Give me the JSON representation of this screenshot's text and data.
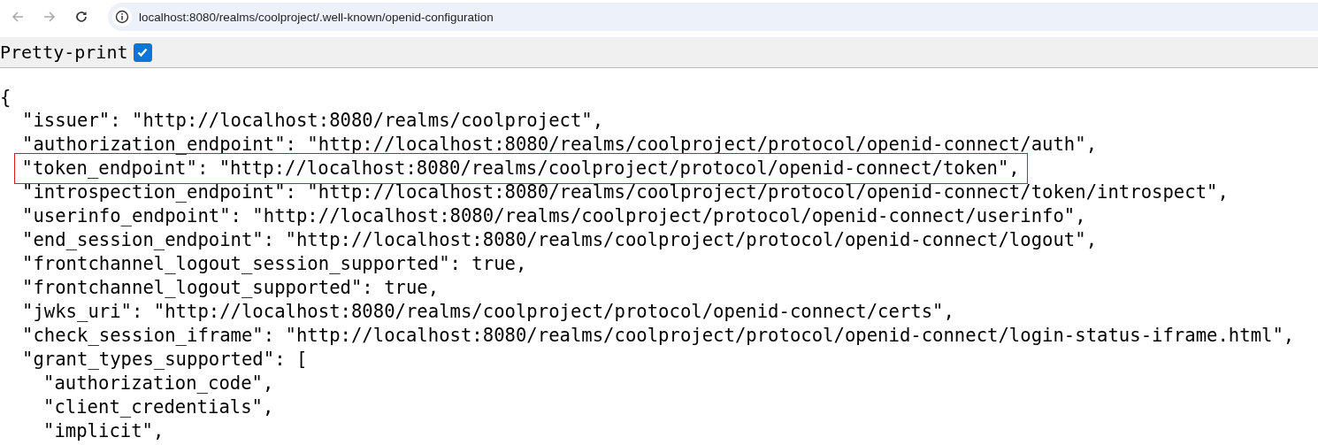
{
  "browser": {
    "url": "localhost:8080/realms/coolproject/.well-known/openid-configuration"
  },
  "toolbar": {
    "label": "Pretty-print",
    "checked": true
  },
  "json_view": {
    "open": "{",
    "lines": [
      {
        "text": "\"issuer\": \"http://localhost:8080/realms/coolproject\",",
        "highlighted": false
      },
      {
        "text": "\"authorization_endpoint\": \"http://localhost:8080/realms/coolproject/protocol/openid-connect/auth\",",
        "highlighted": false
      },
      {
        "text": "\"token_endpoint\": \"http://localhost:8080/realms/coolproject/protocol/openid-connect/token\",",
        "highlighted": true
      },
      {
        "text": "\"introspection_endpoint\": \"http://localhost:8080/realms/coolproject/protocol/openid-connect/token/introspect\",",
        "highlighted": false
      },
      {
        "text": "\"userinfo_endpoint\": \"http://localhost:8080/realms/coolproject/protocol/openid-connect/userinfo\",",
        "highlighted": false
      },
      {
        "text": "\"end_session_endpoint\": \"http://localhost:8080/realms/coolproject/protocol/openid-connect/logout\",",
        "highlighted": false
      },
      {
        "text": "\"frontchannel_logout_session_supported\": true,",
        "highlighted": false
      },
      {
        "text": "\"frontchannel_logout_supported\": true,",
        "highlighted": false
      },
      {
        "text": "\"jwks_uri\": \"http://localhost:8080/realms/coolproject/protocol/openid-connect/certs\",",
        "highlighted": false
      },
      {
        "text": "\"check_session_iframe\": \"http://localhost:8080/realms/coolproject/protocol/openid-connect/login-status-iframe.html\",",
        "highlighted": false
      },
      {
        "text": "\"grant_types_supported\": [",
        "highlighted": false,
        "children": [
          {
            "text": "\"authorization_code\",",
            "highlighted": false
          },
          {
            "text": "\"client_credentials\",",
            "highlighted": false
          },
          {
            "text": "\"implicit\",",
            "highlighted": false
          }
        ]
      }
    ]
  }
}
